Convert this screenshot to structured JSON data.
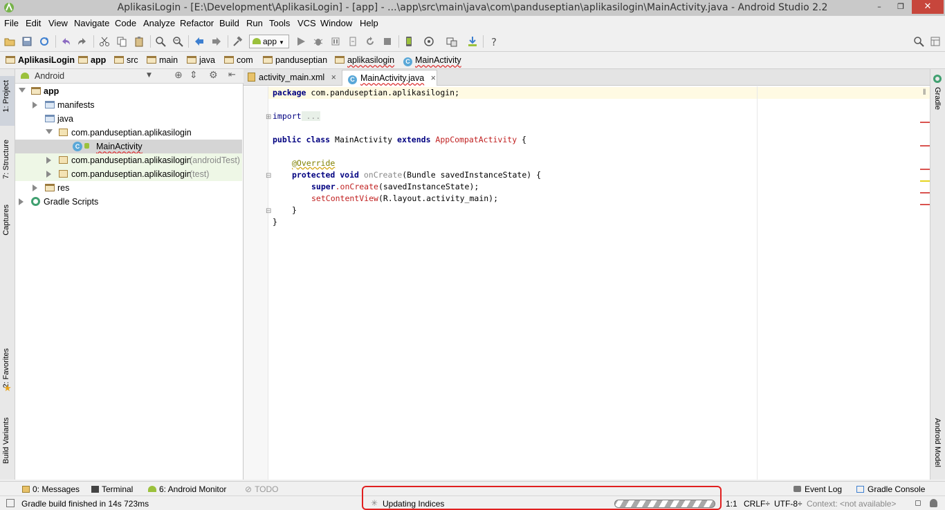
{
  "window": {
    "title": "AplikasiLogin - [E:\\Development\\AplikasiLogin] - [app] - ...\\app\\src\\main\\java\\com\\panduseptian\\aplikasilogin\\MainActivity.java - Android Studio 2.2",
    "buttons": [
      "–",
      "❐",
      "✕"
    ]
  },
  "menu": [
    "File",
    "Edit",
    "View",
    "Navigate",
    "Code",
    "Analyze",
    "Refactor",
    "Build",
    "Run",
    "Tools",
    "VCS",
    "Window",
    "Help"
  ],
  "toolbar": {
    "run_config": "app"
  },
  "breadcrumbs": [
    "AplikasiLogin",
    "app",
    "src",
    "main",
    "java",
    "com",
    "panduseptian",
    "aplikasilogin",
    "MainActivity"
  ],
  "left_tabs": [
    "1: Project",
    "7: Structure",
    "Captures",
    "2: Favorites",
    "Build Variants"
  ],
  "right_tabs": [
    "Gradle",
    "Android Model"
  ],
  "project": {
    "view_selector": "Android",
    "tree": [
      {
        "label": "app",
        "suffix": ""
      },
      {
        "label": "manifests",
        "suffix": ""
      },
      {
        "label": "java",
        "suffix": ""
      },
      {
        "label": "com.panduseptian.aplikasilogin",
        "suffix": ""
      },
      {
        "label": "MainActivity",
        "suffix": ""
      },
      {
        "label": "com.panduseptian.aplikasilogin",
        "suffix": "(androidTest)"
      },
      {
        "label": "com.panduseptian.aplikasilogin",
        "suffix": "(test)"
      },
      {
        "label": "res",
        "suffix": ""
      },
      {
        "label": "Gradle Scripts",
        "suffix": ""
      }
    ]
  },
  "editor": {
    "tabs": [
      {
        "label": "activity_main.xml",
        "close": "×"
      },
      {
        "label": "MainActivity.java",
        "close": "×"
      }
    ],
    "code": {
      "l1_kw": "package",
      "l1_rest": " com.panduseptian.aplikasilogin;",
      "l2_kw": "import",
      "l2_rest": " ...",
      "l3_kw1": "public class",
      "l3_name": " MainActivity ",
      "l3_kw2": "extends",
      "l3_super": " AppCompatActivity",
      "l3_brace": " {",
      "l4_ann": "@Override",
      "l5_kw": "protected void",
      "l5_fn": " onCreate",
      "l5_rest": "(Bundle savedInstanceState) {",
      "l6_kw": "super",
      "l6_fn": ".onCreate",
      "l6_rest": "(savedInstanceState);",
      "l7_fn": "setContentView",
      "l7_rest": "(R.layout.activity_main);",
      "l8": "}",
      "l9": "}"
    }
  },
  "bottom_tools": {
    "messages": "0: Messages",
    "terminal": "Terminal",
    "android_monitor": "6: Android Monitor",
    "todo": "TODO",
    "event_log": "Event Log",
    "gradle_console": "Gradle Console"
  },
  "status": {
    "message": "Gradle build finished in 14s 723ms",
    "task": "Updating Indices",
    "position": "1:1",
    "line_sep": "CRLF÷",
    "encoding": "UTF-8÷",
    "context": "Context: <not available>"
  },
  "colors": {
    "accent": "#e02020",
    "android_green": "#9bc13c"
  }
}
